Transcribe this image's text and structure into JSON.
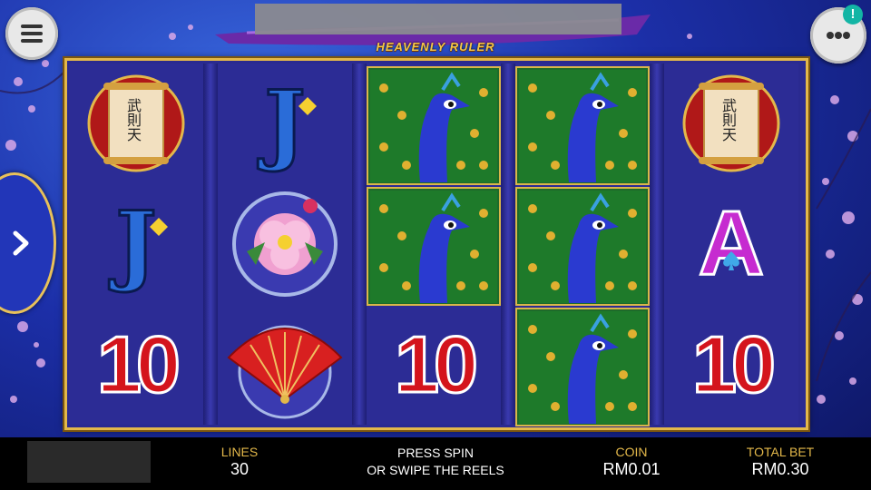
{
  "game": {
    "subtitle": "HEAVENLY RULER"
  },
  "buttons": {
    "menu_icon": "hamburger-menu-icon",
    "chat_icon": "ellipsis-icon",
    "notification_badge": "!",
    "side_arrow_icon": "chevron-right-icon"
  },
  "reels": [
    [
      "scroll",
      "J",
      "10"
    ],
    [
      "J",
      "peony",
      "fan"
    ],
    [
      "peacock",
      "peacock",
      "10"
    ],
    [
      "peacock",
      "peacock",
      "peacock"
    ],
    [
      "scroll",
      "A",
      "10"
    ]
  ],
  "symbols": {
    "ten": "10",
    "jack": "J",
    "ace": "A",
    "scroll_text": "武則天"
  },
  "footer": {
    "lines_label": "LINES",
    "lines_value": "30",
    "press_spin_line1": "PRESS SPIN",
    "press_spin_line2": "OR SWIPE THE REELS",
    "coin_label": "COIN",
    "coin_value": "RM0.01",
    "total_bet_label": "TOTAL BET",
    "total_bet_value": "RM0.30"
  },
  "colors": {
    "gold": "#e3b84a",
    "red_symbol": "#d4141c",
    "blue_symbol": "#2a6cd8",
    "magenta_symbol": "#c62bd0",
    "peacock_green": "#1e6a2a"
  }
}
